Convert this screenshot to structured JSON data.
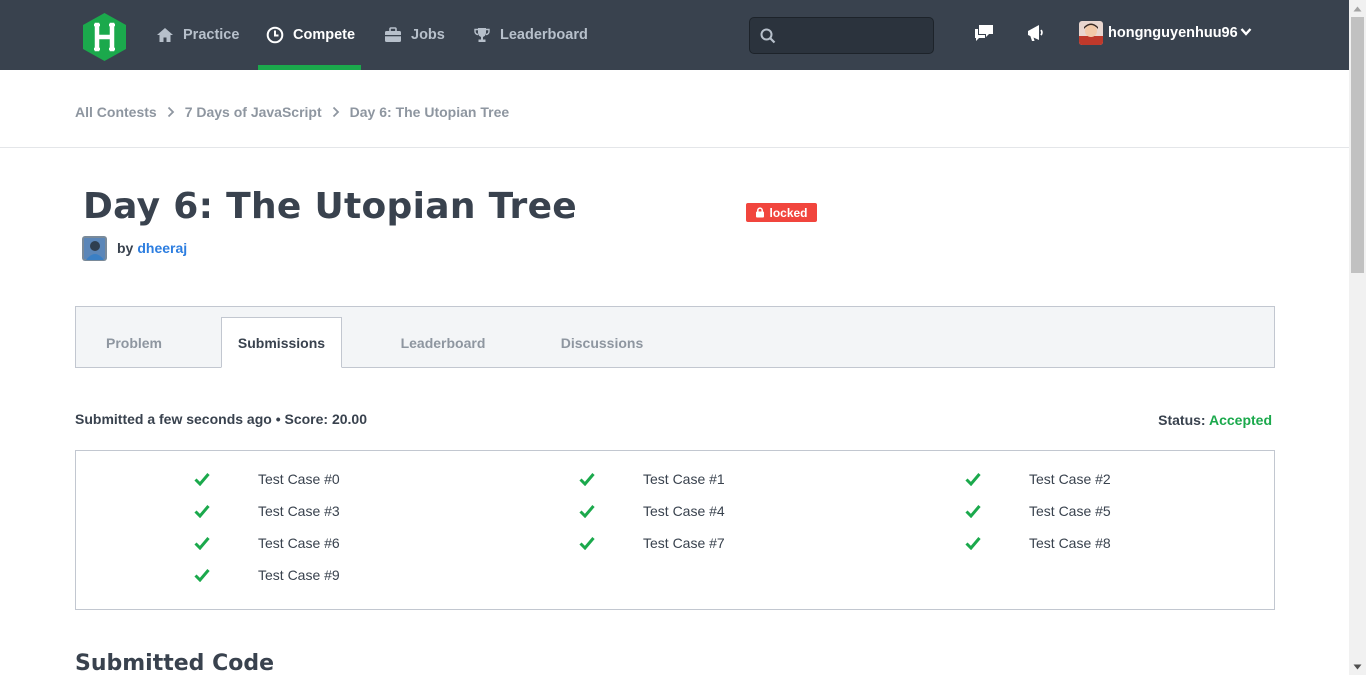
{
  "nav": {
    "items": [
      {
        "label": "Practice",
        "icon": "home-icon"
      },
      {
        "label": "Compete",
        "icon": "clock-icon"
      },
      {
        "label": "Jobs",
        "icon": "briefcase-icon"
      },
      {
        "label": "Leaderboard",
        "icon": "trophy-icon"
      }
    ],
    "active": "Compete",
    "search_value": "",
    "username": "hongnguyenhuu96"
  },
  "breadcrumb": [
    "All Contests",
    "7 Days of JavaScript",
    "Day 6: The Utopian Tree"
  ],
  "challenge": {
    "title": "Day 6: The Utopian Tree",
    "badge": "locked",
    "by_label": "by",
    "author": "dheeraj"
  },
  "tabs": [
    "Problem",
    "Submissions",
    "Leaderboard",
    "Discussions"
  ],
  "active_tab": "Submissions",
  "submission": {
    "meta": "Submitted a few seconds ago • Score: 20.00",
    "status_label": "Status:",
    "status_value": "Accepted",
    "test_cases": [
      "Test Case #0",
      "Test Case #1",
      "Test Case #2",
      "Test Case #3",
      "Test Case #4",
      "Test Case #5",
      "Test Case #6",
      "Test Case #7",
      "Test Case #8",
      "Test Case #9"
    ]
  },
  "sections": {
    "submitted_code": "Submitted Code"
  },
  "colors": {
    "nav_bg": "#39424e",
    "accent_green": "#1ba94c",
    "locked_red": "#f1453d",
    "link_blue": "#2d7ee0"
  }
}
